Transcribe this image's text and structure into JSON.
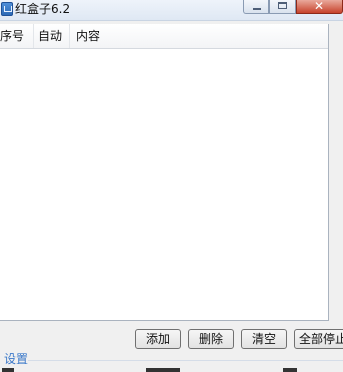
{
  "window": {
    "title": "红盒子6.2"
  },
  "caption": {
    "close_glyph": "✕"
  },
  "list": {
    "columns": [
      "序号",
      "自动",
      "内容"
    ],
    "rows": []
  },
  "buttons": {
    "add": "添加",
    "delete": "删除",
    "clear": "清空",
    "stop_all": "全部停止"
  },
  "settings": {
    "label": "设置"
  },
  "colors": {
    "settings_label": "#3a78c9",
    "close_button": "#c7432c"
  }
}
